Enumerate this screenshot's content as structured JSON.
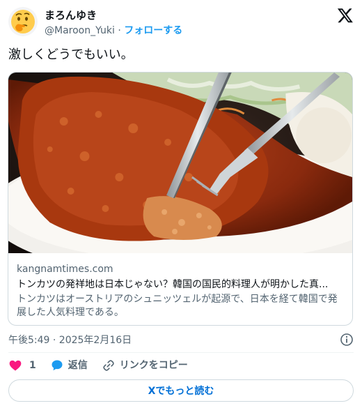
{
  "author": {
    "display_name": "まろんゆき",
    "handle": "@Maroon_Yuki",
    "separator": "·",
    "follow_label": "フォローする",
    "avatar_icon": "thinking-face-emoji"
  },
  "tweet": {
    "text": "激しくどうでもいい。"
  },
  "link_card": {
    "image_description_icon": "tonkatsu-photo",
    "domain": "kangnamtimes.com",
    "title": "トンカツの発祥地は日本じゃない？韓国の国民的料理人が明かした真...",
    "description": "トンカツはオーストリアのシュニッツェルが起源で、日本を経て韓国で発展した人気料理である。"
  },
  "timestamp": "午後5:49 · 2025年2月16日",
  "actions": {
    "like_count": "1",
    "reply_label": "返信",
    "copy_link_label": "リンクをコピー"
  },
  "read_more_label": "Xでもっと読む",
  "colors": {
    "accent": "#1d9bf0",
    "like": "#f91880",
    "read_more_text": "#006fd6",
    "muted": "#536471",
    "border": "#cfd9de"
  }
}
